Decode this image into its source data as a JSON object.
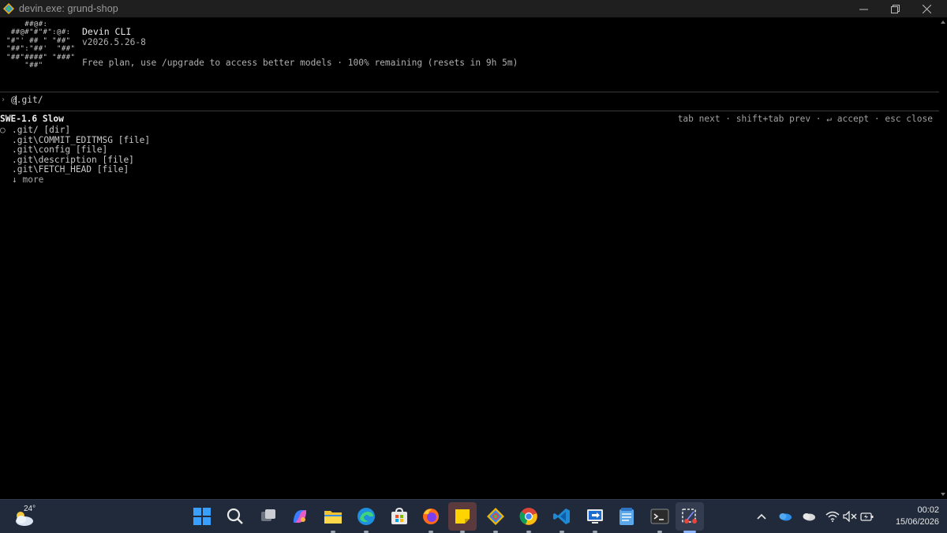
{
  "window": {
    "title": "devin.exe: grund-shop"
  },
  "header": {
    "logo_art": "    ##@#:\n ##@#\"#\"#\":@#:\n\"#\"' ## \" \"##\"\n\"##\":\"##'  \"##\"\n\"##\"####\" \"###\"\n    \"##\"",
    "app_name": "Devin CLI",
    "version": "v2026.5.26-8",
    "plan_text": "Free plan, use /upgrade to access better models · 100% remaining (resets in 9h 5m)"
  },
  "prompt": {
    "chevron": "›",
    "before_caret": "@",
    "after_caret": ".git/"
  },
  "autocomplete": {
    "model": "SWE-1.6 Slow",
    "hints": "tab next · shift+tab prev · ↵ accept · esc close",
    "items": [
      {
        "mark": "○",
        "text": ".git/ [dir]"
      },
      {
        "mark": "",
        "text": ".git\\COMMIT_EDITMSG [file]"
      },
      {
        "mark": "",
        "text": ".git\\config [file]"
      },
      {
        "mark": "",
        "text": ".git\\description [file]"
      },
      {
        "mark": "",
        "text": ".git\\FETCH_HEAD [file]"
      }
    ],
    "more": "↓ more"
  },
  "taskbar": {
    "weather_temp": "24°",
    "apps": [
      "windows-start",
      "search",
      "task-view",
      "copilot",
      "file-explorer",
      "edge",
      "microsoft-store",
      "firefox",
      "sticky-notes",
      "git",
      "chrome",
      "vscode",
      "remote-desktop",
      "notepad",
      "terminal",
      "snipping-tool"
    ]
  },
  "tray": {
    "time": "00:02",
    "date": "15/06/2026"
  },
  "colors": {
    "terminal_bg": "#000000",
    "taskbar_bg": "#202a3a",
    "active_app_bg": "#5a3a3c"
  }
}
